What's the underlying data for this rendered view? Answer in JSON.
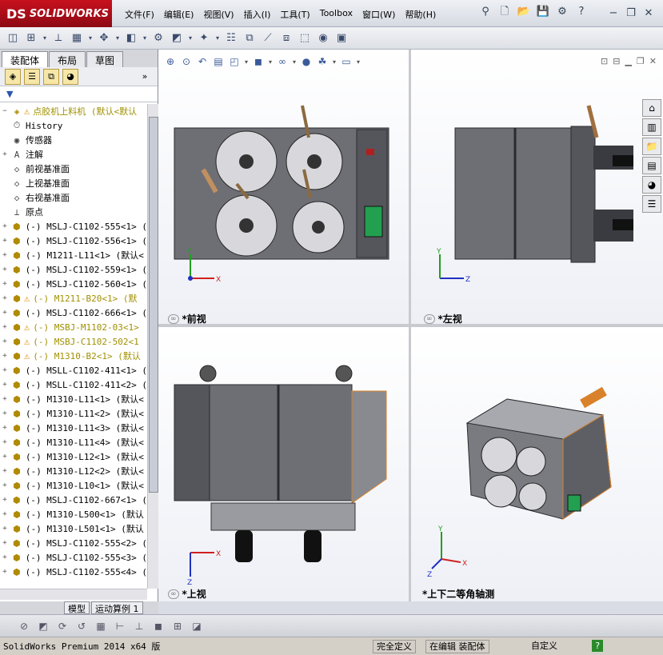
{
  "app": {
    "logo_ds": "DS",
    "logo_text": "SOLIDWORKS"
  },
  "menu": [
    "文件(F)",
    "编辑(E)",
    "视图(V)",
    "插入(I)",
    "工具(T)",
    "Toolbox",
    "窗口(W)",
    "帮助(H)"
  ],
  "tabs": {
    "assembly": "装配体",
    "layout": "布局",
    "sketch": "草图"
  },
  "tree": [
    {
      "label": "点胶机上料机  (默认<默认",
      "icon": "asm",
      "warn": true,
      "yellow": true,
      "expand": "−"
    },
    {
      "label": "History",
      "icon": "history",
      "expand": ""
    },
    {
      "label": "传感器",
      "icon": "sensor",
      "expand": ""
    },
    {
      "label": "注解",
      "icon": "annot",
      "expand": "+"
    },
    {
      "label": "前视基准面",
      "icon": "plane",
      "expand": ""
    },
    {
      "label": "上视基准面",
      "icon": "plane",
      "expand": ""
    },
    {
      "label": "右视基准面",
      "icon": "plane",
      "expand": ""
    },
    {
      "label": "原点",
      "icon": "origin",
      "expand": ""
    },
    {
      "label": "(-) MSLJ-C1102-555<1> (",
      "icon": "part",
      "expand": "+"
    },
    {
      "label": "(-) MSLJ-C1102-556<1> (",
      "icon": "part",
      "expand": "+"
    },
    {
      "label": "(-) M1211-L11<1> (默认<",
      "icon": "part",
      "expand": "+"
    },
    {
      "label": "(-) MSLJ-C1102-559<1> (",
      "icon": "part",
      "expand": "+"
    },
    {
      "label": "(-) MSLJ-C1102-560<1> (",
      "icon": "part",
      "expand": "+"
    },
    {
      "label": "(-) M1211-B20<1> (默",
      "icon": "part",
      "warn": true,
      "yellow": true,
      "expand": "+"
    },
    {
      "label": "(-) MSLJ-C1102-666<1> (",
      "icon": "part",
      "expand": "+"
    },
    {
      "label": "(-) MSBJ-M1102-03<1>",
      "icon": "part",
      "warn": true,
      "yellow": true,
      "expand": "+"
    },
    {
      "label": "(-) MSBJ-C1102-502<1",
      "icon": "part",
      "warn": true,
      "yellow": true,
      "expand": "+"
    },
    {
      "label": "(-) M1310-B2<1> (默认",
      "icon": "part",
      "warn": true,
      "yellow": true,
      "expand": "+"
    },
    {
      "label": "(-) MSLL-C1102-411<1> (",
      "icon": "part",
      "expand": "+"
    },
    {
      "label": "(-) MSLL-C1102-411<2> (",
      "icon": "part",
      "expand": "+"
    },
    {
      "label": "(-) M1310-L11<1> (默认<",
      "icon": "part",
      "expand": "+"
    },
    {
      "label": "(-) M1310-L11<2> (默认<",
      "icon": "part",
      "expand": "+"
    },
    {
      "label": "(-) M1310-L11<3> (默认<",
      "icon": "part",
      "expand": "+"
    },
    {
      "label": "(-) M1310-L11<4> (默认<",
      "icon": "part",
      "expand": "+"
    },
    {
      "label": "(-) M1310-L12<1> (默认<",
      "icon": "part",
      "expand": "+"
    },
    {
      "label": "(-) M1310-L12<2> (默认<",
      "icon": "part",
      "expand": "+"
    },
    {
      "label": "(-) M1310-L10<1> (默认<",
      "icon": "part",
      "expand": "+"
    },
    {
      "label": "(-) MSLJ-C1102-667<1> (",
      "icon": "part",
      "expand": "+"
    },
    {
      "label": "(-) M1310-L500<1> (默认",
      "icon": "part",
      "expand": "+"
    },
    {
      "label": "(-) M1310-L501<1> (默认",
      "icon": "part",
      "expand": "+"
    },
    {
      "label": "(-) MSLJ-C1102-555<2> (",
      "icon": "part",
      "expand": "+"
    },
    {
      "label": "(-) MSLJ-C1102-555<3> (",
      "icon": "part",
      "expand": "+"
    },
    {
      "label": "(-) MSLJ-C1102-555<4> (",
      "icon": "part",
      "expand": "+"
    }
  ],
  "bottom_tabs": {
    "model": "模型",
    "motion": "运动算例 1"
  },
  "views": {
    "front": "*前视",
    "left": "*左视",
    "top": "*上视",
    "iso": "*上下二等角轴测"
  },
  "axes": {
    "x": "X",
    "y": "Y",
    "z": "Z"
  },
  "status": {
    "product": "SolidWorks Premium 2014 x64 版",
    "defined": "完全定义",
    "editing": "在编辑 装配体",
    "custom": "自定义"
  },
  "colors": {
    "accent": "#c8101e",
    "body": "#6e6f74",
    "frame": "#4a4b50",
    "screen": "#22a050",
    "orange": "#d9822b"
  }
}
